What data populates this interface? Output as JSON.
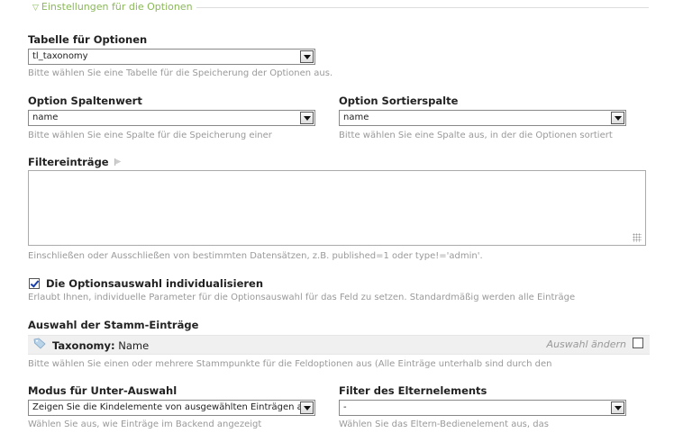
{
  "fieldset": {
    "legend": "Einstellungen für die Optionen"
  },
  "table_options": {
    "label": "Tabelle für Optionen",
    "value": "tl_taxonomy",
    "tip": "Bitte wählen Sie eine Tabelle für die Speicherung der Optionen aus."
  },
  "value_column": {
    "label": "Option Spaltenwert",
    "value": "name",
    "tip": "Bitte wählen Sie eine Spalte für die Speicherung einer"
  },
  "sort_column": {
    "label": "Option Sortierspalte",
    "value": "name",
    "tip": "Bitte wählen Sie eine Spalte aus, in der die Optionen sortiert"
  },
  "filter": {
    "label": "Filtereinträge",
    "value": "",
    "tip": "Einschließen oder Ausschließen von bestimmten Datensätzen, z.B. published=1 oder type!='admin'."
  },
  "customize": {
    "label": "Die Optionsauswahl individualisieren",
    "checked": true,
    "tip": "Erlaubt Ihnen, individuelle Parameter für die Optionsauswahl für das Feld zu setzen. Standardmäßig werden alle Einträge"
  },
  "root_entries": {
    "label": "Auswahl der Stamm-Einträge",
    "item_type": "Taxonomy:",
    "item_name": "Name",
    "change_label": "Auswahl ändern",
    "tip": "Bitte wählen Sie einen oder mehrere Stammpunkte für die Feldoptionen aus (Alle Einträge unterhalb sind durch den"
  },
  "sub_mode": {
    "label": "Modus für Unter-Auswahl",
    "value": "Zeigen Sie die Kindelemente von ausgewählten Einträgen an",
    "tip": "Wählen Sie aus, wie Einträge im Backend angezeigt"
  },
  "parent_filter": {
    "label": "Filter des Elternelements",
    "value": "-",
    "tip": "Wählen Sie das Eltern-Bedienelement aus, das"
  },
  "colors": {
    "legend": "#8ab858",
    "tip": "#999999",
    "bar": "#f0f0f0"
  },
  "icons": {
    "legend_toggle": "triangle-down-icon",
    "help": "flag-icon",
    "tag": "tag-icon",
    "dropdown": "chevron-down-icon"
  }
}
